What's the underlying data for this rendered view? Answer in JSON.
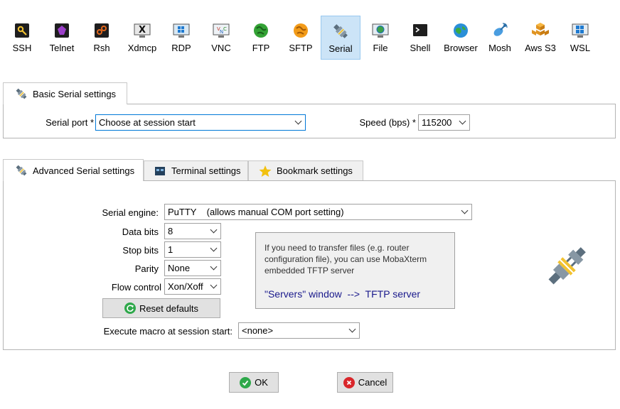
{
  "toolbar": {
    "items": [
      {
        "label": "SSH",
        "icon": "ssh-icon"
      },
      {
        "label": "Telnet",
        "icon": "telnet-icon"
      },
      {
        "label": "Rsh",
        "icon": "rsh-icon"
      },
      {
        "label": "Xdmcp",
        "icon": "xdmcp-icon"
      },
      {
        "label": "RDP",
        "icon": "rdp-icon"
      },
      {
        "label": "VNC",
        "icon": "vnc-icon"
      },
      {
        "label": "FTP",
        "icon": "ftp-icon"
      },
      {
        "label": "SFTP",
        "icon": "sftp-icon"
      },
      {
        "label": "Serial",
        "icon": "serial-plug-icon",
        "active": true
      },
      {
        "label": "File",
        "icon": "file-icon"
      },
      {
        "label": "Shell",
        "icon": "shell-icon"
      },
      {
        "label": "Browser",
        "icon": "browser-globe-icon"
      },
      {
        "label": "Mosh",
        "icon": "mosh-icon"
      },
      {
        "label": "Aws S3",
        "icon": "aws-s3-icon"
      },
      {
        "label": "WSL",
        "icon": "wsl-icon"
      }
    ]
  },
  "basic": {
    "tab_label": "Basic Serial settings",
    "serial_port_label": "Serial port *",
    "serial_port_value": "Choose at session start",
    "speed_label": "Speed (bps) *",
    "speed_value": "115200"
  },
  "advanced": {
    "tabs": [
      {
        "label": "Advanced Serial settings",
        "icon": "serial-plug-icon"
      },
      {
        "label": "Terminal settings",
        "icon": "terminal-icon"
      },
      {
        "label": "Bookmark settings",
        "icon": "star-icon"
      }
    ],
    "engine_label": "Serial engine:",
    "engine_value": "PuTTY    (allows manual COM port setting)",
    "data_bits_label": "Data bits",
    "data_bits_value": "8",
    "stop_bits_label": "Stop bits",
    "stop_bits_value": "1",
    "parity_label": "Parity",
    "parity_value": "None",
    "flow_label": "Flow control",
    "flow_value": "Xon/Xoff",
    "reset_label": "Reset defaults",
    "info_text": "If you need to transfer files (e.g. router configuration file), you can use MobaXterm embedded TFTP server",
    "info_link": "\"Servers\" window  -->  TFTP server",
    "macro_label": "Execute macro at session start:",
    "macro_value": "<none>"
  },
  "footer": {
    "ok_label": "OK",
    "cancel_label": "Cancel"
  },
  "colors": {
    "active_tool_bg": "#cce4f7",
    "ok_green": "#2ea84a",
    "cancel_red": "#d9262b",
    "link_blue": "#1a1a8c"
  }
}
